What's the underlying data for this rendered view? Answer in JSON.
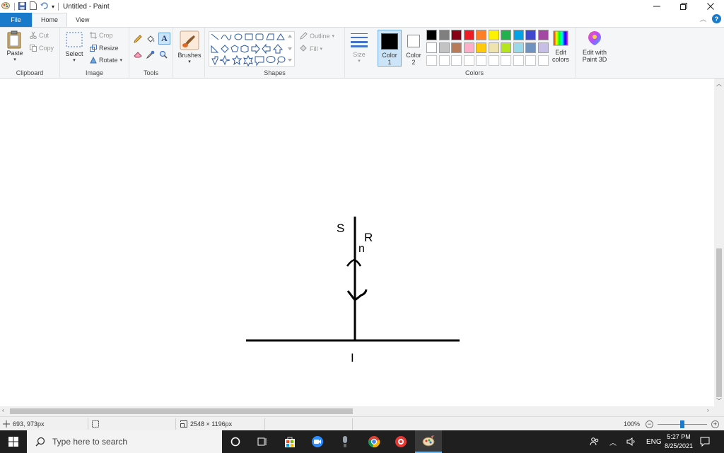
{
  "window": {
    "title": "Untitled - Paint"
  },
  "tabs": [
    {
      "label": "File"
    },
    {
      "label": "Home"
    },
    {
      "label": "View"
    }
  ],
  "ribbon": {
    "clipboard": {
      "label": "Clipboard",
      "paste": "Paste",
      "cut": "Cut",
      "copy": "Copy"
    },
    "image": {
      "label": "Image",
      "select": "Select",
      "crop": "Crop",
      "resize": "Resize",
      "rotate": "Rotate"
    },
    "tools": {
      "label": "Tools"
    },
    "brushes": {
      "label": "Brushes"
    },
    "shapes": {
      "label": "Shapes",
      "outline": "Outline",
      "fill": "Fill"
    },
    "size": {
      "label": "Size"
    },
    "colors": {
      "label": "Colors",
      "color1": "Color",
      "color1_num": "1",
      "color2": "Color",
      "color2_num": "2",
      "edit_colors_1": "Edit",
      "edit_colors_2": "colors",
      "paint3d_1": "Edit with",
      "paint3d_2": "Paint 3D",
      "color1_value": "#000000",
      "color2_value": "#ffffff",
      "palette_row1": [
        "#000000",
        "#7f7f7f",
        "#880015",
        "#ed1c24",
        "#ff7f27",
        "#fff200",
        "#22b14c",
        "#00a2e8",
        "#3f48cc",
        "#a349a4"
      ],
      "palette_row2": [
        "#ffffff",
        "#c3c3c3",
        "#b97a57",
        "#ffaec9",
        "#ffc90e",
        "#efe4b0",
        "#b5e61d",
        "#99d9ea",
        "#7092be",
        "#c8bfe7"
      ]
    }
  },
  "canvas": {
    "labels": {
      "S": "S",
      "R": "R",
      "n": "n",
      "I": "I"
    }
  },
  "status": {
    "cursor_pos": "693, 973px",
    "image_size": "2548 × 1196px",
    "zoom": "100%",
    "zoom_slider_fraction": 0.5
  },
  "taskbar": {
    "search_placeholder": "Type here to search",
    "lang": "ENG",
    "time": "5:27 PM",
    "date": "8/25/2021"
  }
}
